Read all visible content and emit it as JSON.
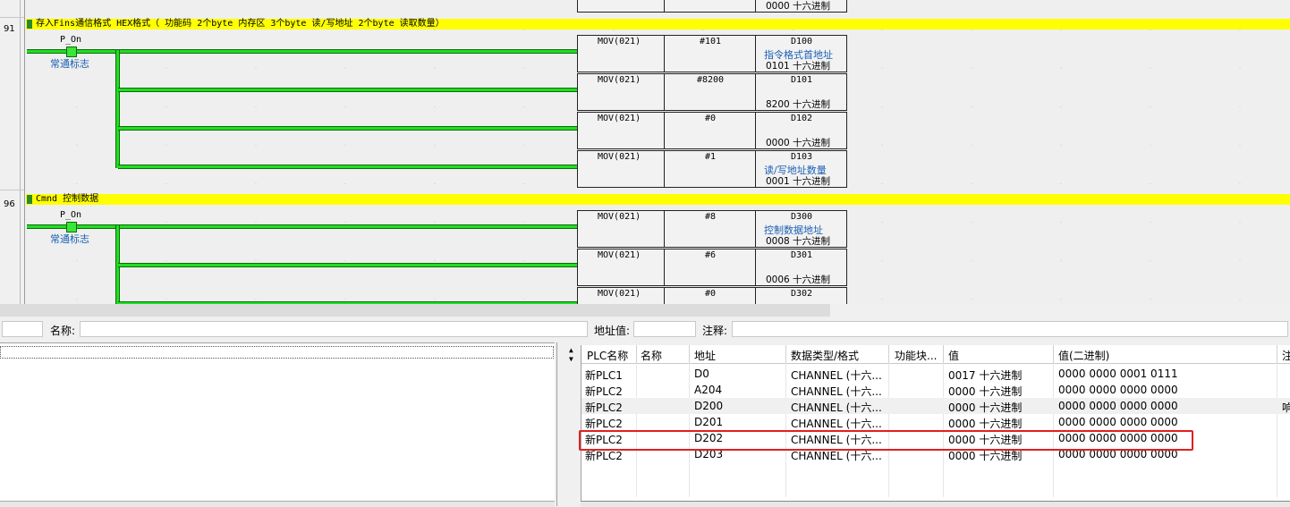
{
  "ladder": {
    "rungs": [
      {
        "number": "91",
        "comment": "存入Fins通信格式 HEX格式（ 功能码 2个byte 内存区 3个byte  读/写地址 2个byte  读取数量）"
      },
      {
        "number": "96",
        "comment": "Cmnd 控制数据"
      }
    ],
    "top_partial_value": "0000 十六进制",
    "contact_label": "P_On",
    "contact_comment": "常通标志",
    "instructions_91": [
      {
        "op": "MOV(021)",
        "src": "#101",
        "dst": "D100",
        "note": "指令格式首地址",
        "value": "0101 十六进制"
      },
      {
        "op": "MOV(021)",
        "src": "#8200",
        "dst": "D101",
        "note": "",
        "value": "8200 十六进制"
      },
      {
        "op": "MOV(021)",
        "src": "#0",
        "dst": "D102",
        "note": "",
        "value": "0000 十六进制"
      },
      {
        "op": "MOV(021)",
        "src": "#1",
        "dst": "D103",
        "note": "读/写地址数量",
        "value": "0001 十六进制"
      }
    ],
    "instructions_96": [
      {
        "op": "MOV(021)",
        "src": "#8",
        "dst": "D300",
        "note": "控制数据地址",
        "value": "0008 十六进制"
      },
      {
        "op": "MOV(021)",
        "src": "#6",
        "dst": "D301",
        "note": "",
        "value": "0006 十六进制"
      },
      {
        "op": "MOV(021)",
        "src": "#0",
        "dst": "D302",
        "note": "",
        "value": ""
      }
    ]
  },
  "fieldbar": {
    "name_label": "名称:",
    "address_label": "地址值:",
    "comment_label": "注释:"
  },
  "watch": {
    "headers": [
      "PLC名称",
      "名称",
      "地址",
      "数据类型/格式",
      "功能块...",
      "值",
      "值(二进制)",
      "注"
    ],
    "rows": [
      {
        "plc": "新PLC1",
        "name": "",
        "addr": "D0",
        "type": "CHANNEL (十六...",
        "fb": "",
        "value": "0017 十六进制",
        "bin": "0000 0000 0001 0111",
        "note": ""
      },
      {
        "plc": "新PLC2",
        "name": "",
        "addr": "A204",
        "type": "CHANNEL (十六...",
        "fb": "",
        "value": "0000 十六进制",
        "bin": "0000 0000 0000 0000",
        "note": ""
      },
      {
        "plc": "新PLC2",
        "name": "",
        "addr": "D200",
        "type": "CHANNEL (十六...",
        "fb": "",
        "value": "0000 十六进制",
        "bin": "0000 0000 0000 0000",
        "note": "响"
      },
      {
        "plc": "新PLC2",
        "name": "",
        "addr": "D201",
        "type": "CHANNEL (十六...",
        "fb": "",
        "value": "0000 十六进制",
        "bin": "0000 0000 0000 0000",
        "note": ""
      },
      {
        "plc": "新PLC2",
        "name": "",
        "addr": "D202",
        "type": "CHANNEL (十六...",
        "fb": "",
        "value": "0000 十六进制",
        "bin": "0000 0000 0000 0000",
        "note": ""
      },
      {
        "plc": "新PLC2",
        "name": "",
        "addr": "D203",
        "type": "CHANNEL (十六...",
        "fb": "",
        "value": "0000 十六进制",
        "bin": "0000 0000 0000 0000",
        "note": ""
      }
    ],
    "highlighted_row": "D202"
  },
  "colors": {
    "comment_bg": "#ffff00",
    "wire": "#22dd22",
    "note": "#1a5fb4",
    "highlight": "#e02020"
  }
}
